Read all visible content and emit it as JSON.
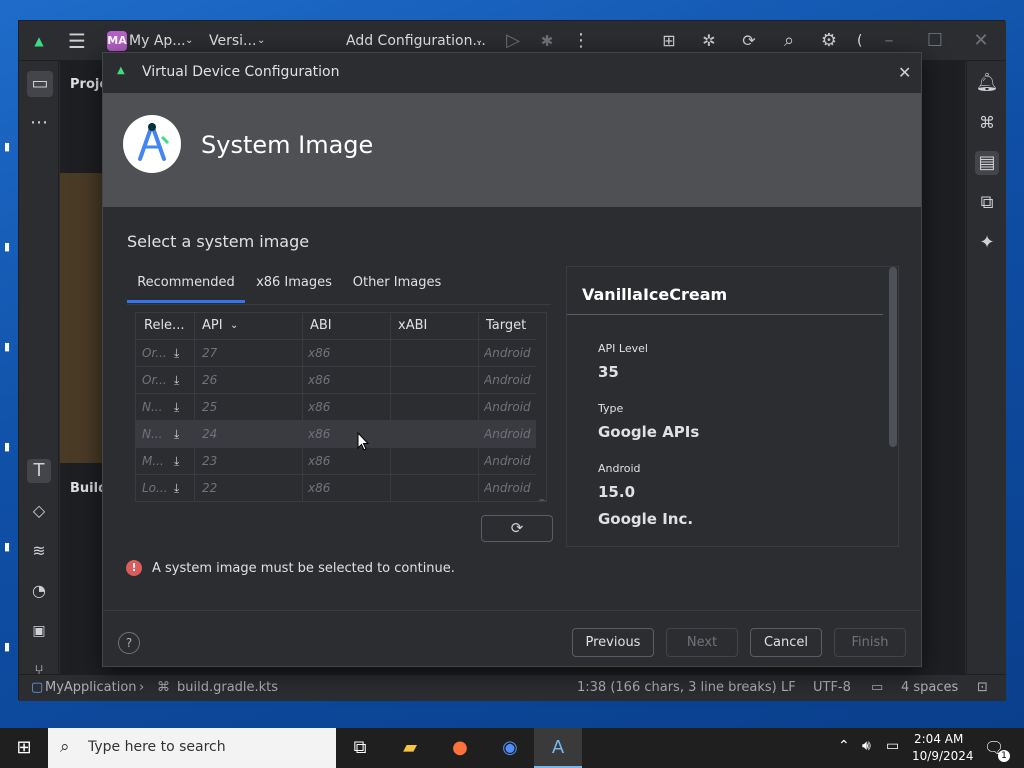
{
  "colors": {
    "accent": "#3574f0",
    "error": "#db5c5c",
    "ide_bg": "#2b2d30",
    "banner_bg": "#4e5053",
    "taskbar_bg": "#1f1f1f"
  },
  "ide": {
    "project_badge": "MA",
    "project_name": "My Ap...",
    "vcs_label": "Versi...",
    "run_config": "Add Configuration...",
    "paren": "(",
    "project_panel_label": "Proje",
    "build_panel_label": "Build"
  },
  "dialog": {
    "window_title": "Virtual Device Configuration",
    "header_title": "System Image",
    "section_title": "Select a system image",
    "tabs": [
      "Recommended",
      "x86 Images",
      "Other Images"
    ],
    "table": {
      "headers": [
        "Rele...",
        "API",
        "ABI",
        "xABI",
        "Target"
      ],
      "rows": [
        {
          "release": "Or...",
          "api": "27",
          "abi": "x86",
          "xabi": "",
          "target": "Android"
        },
        {
          "release": "Or...",
          "api": "26",
          "abi": "x86",
          "xabi": "",
          "target": "Android"
        },
        {
          "release": "N...",
          "api": "25",
          "abi": "x86",
          "xabi": "",
          "target": "Android"
        },
        {
          "release": "N...",
          "api": "24",
          "abi": "x86",
          "xabi": "",
          "target": "Android"
        },
        {
          "release": "M...",
          "api": "23",
          "abi": "x86",
          "xabi": "",
          "target": "Android"
        },
        {
          "release": "Lo...",
          "api": "22",
          "abi": "x86",
          "xabi": "",
          "target": "Android"
        }
      ]
    },
    "details": {
      "name": "VanillaIceCream",
      "api_level_label": "API Level",
      "api_level": "35",
      "type_label": "Type",
      "type": "Google APIs",
      "android_label": "Android",
      "android_version": "15.0",
      "vendor": "Google Inc."
    },
    "error_message": "A system image must be selected to continue.",
    "buttons": {
      "help": "?",
      "previous": "Previous",
      "next": "Next",
      "cancel": "Cancel",
      "finish": "Finish"
    }
  },
  "statusbar": {
    "project": "MyApplication",
    "file": "build.gradle.kts",
    "position": "1:38 (166 chars, 3 line breaks)",
    "line_ending": "LF",
    "encoding": "UTF-8",
    "indent": "4 spaces"
  },
  "taskbar": {
    "search_placeholder": "Type here to search",
    "time": "2:04 AM",
    "date": "10/9/2024",
    "notification_count": "1"
  },
  "icons": [
    "android-icon",
    "hamburger-menu-icon",
    "chevron-down-icon",
    "run-icon",
    "debug-icon",
    "more-icon",
    "device-manager-icon",
    "bug-icon",
    "sync-icon",
    "search-icon",
    "settings-icon",
    "minimize-icon",
    "maximize-icon",
    "close-icon",
    "folder-icon",
    "hammer-icon",
    "gem-icon",
    "terminal-icon",
    "git-icon",
    "bell-icon",
    "gradle-icon",
    "sparkle-icon",
    "download-icon",
    "refresh-icon",
    "error-icon",
    "help-icon",
    "windows-start-icon",
    "task-view-icon",
    "file-explorer-icon",
    "firefox-icon",
    "chrome-icon",
    "android-studio-icon",
    "wifi-icon",
    "volume-icon",
    "notification-icon"
  ]
}
